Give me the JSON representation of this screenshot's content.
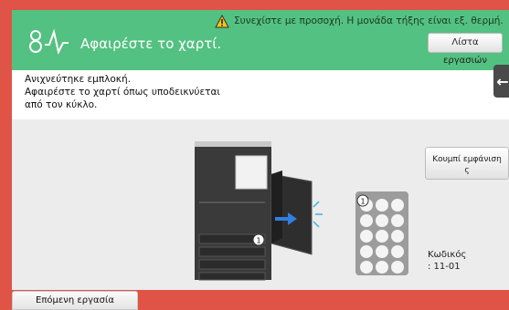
{
  "header": {
    "warning_text": "Συνεχίστε με προσοχή. Η μονάδα τήξης είναι εξ. θερμή.",
    "title": "Αφαιρέστε το χαρτί.",
    "job_list_button": "Λίστα εργασιών",
    "header_color": "#53c181"
  },
  "message": {
    "line1": "Ανιχνεύτηκε εμπλοκή.",
    "line2": "Αφαιρέστε το χαρτί όπως υποδεικνύεται",
    "line3": "από τον κύκλο."
  },
  "side": {
    "display_button_line1": "Κουμπί εμφάνιση",
    "display_button_line2": "ς",
    "code_label": "Κωδικός",
    "code_value": ": 11-01"
  },
  "illustration": {
    "marker_label": "1",
    "mini_panel_marker": "1"
  },
  "footer": {
    "next_job_button": "Επόμενη εργασία"
  },
  "colors": {
    "frame": "#e05347",
    "header": "#53c181"
  },
  "icons": {
    "warning": "warning-icon",
    "app_logo": "logo-icon",
    "back": "back-arrow-icon"
  }
}
